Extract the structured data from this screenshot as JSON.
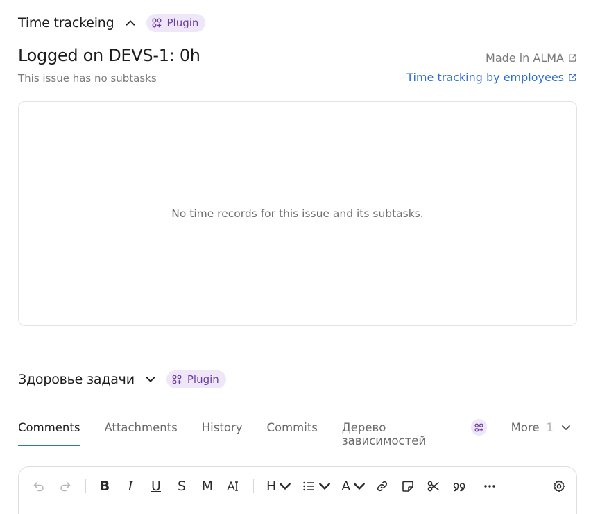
{
  "time_section": {
    "title": "Time trackeing",
    "badge": "Plugin",
    "logged_title": "Logged on DEVS-1:",
    "logged_value": "0h",
    "subtasks_note": "This issue has no subtasks",
    "made_in": "Made in ALMA",
    "employees_link": "Time tracking by employees",
    "empty_message": "No time records for this issue and its subtasks."
  },
  "health_section": {
    "title": "Здоровье задачи",
    "badge": "Plugin"
  },
  "tabs": {
    "items": [
      "Comments",
      "Attachments",
      "History",
      "Commits",
      "Дерево зависимостей"
    ],
    "active": "Comments",
    "more_label": "More",
    "more_count": "1"
  },
  "editor": {
    "heading_label": "H",
    "color_label": "A",
    "bold_label": "B",
    "italic_label": "I",
    "underline_label": "U",
    "strike_label": "S",
    "mono_label": "M"
  },
  "colors": {
    "accent": "#2f6fd6",
    "plugin_bg": "#efe6f8",
    "plugin_fg": "#6b3fa0"
  }
}
